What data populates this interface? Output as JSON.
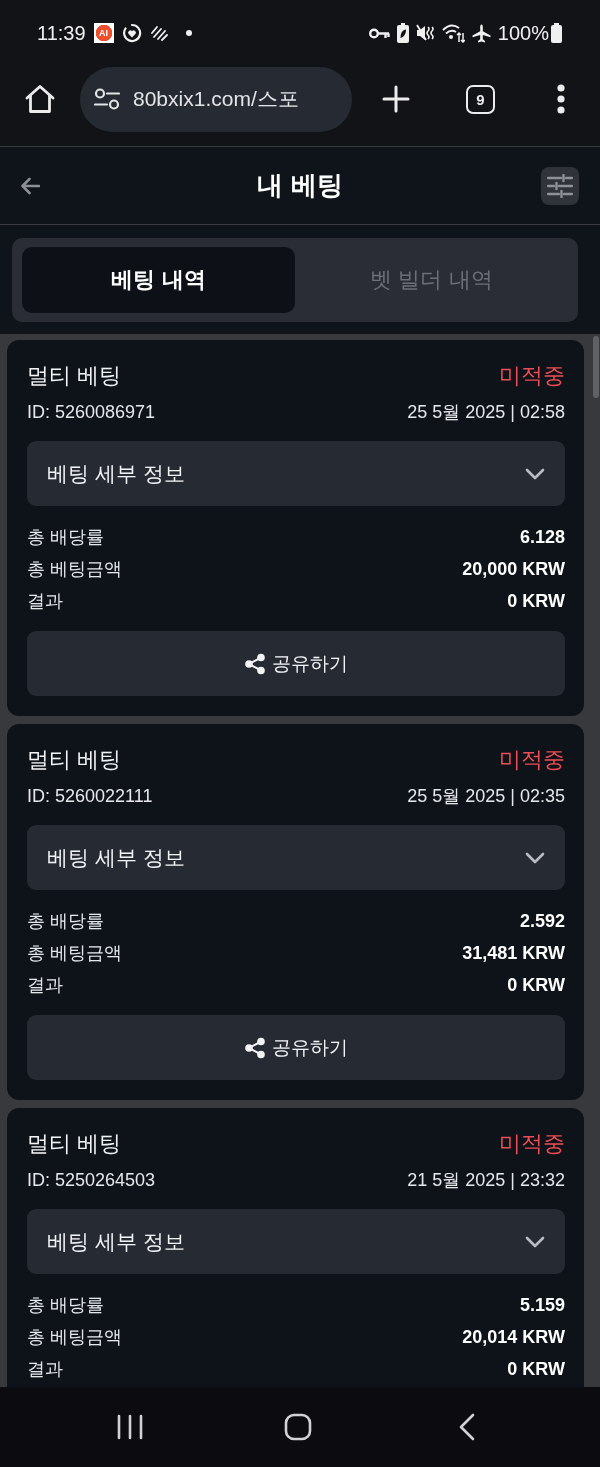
{
  "status_bar": {
    "time": "11:39",
    "app_logo": "AI",
    "battery": "100%"
  },
  "browser": {
    "url": "80bxix1.com/스포",
    "tab_count": "9"
  },
  "header": {
    "title": "내 베팅"
  },
  "tabs": [
    {
      "label": "베팅 내역",
      "selected": true
    },
    {
      "label": "벳 빌더 내역",
      "selected": false
    }
  ],
  "bets": [
    {
      "type": "멀티 베팅",
      "status": "미적중",
      "id": "ID: 5260086971",
      "date": "25 5월 2025 | 02:58",
      "details": {
        "label": "베팅 세부 정보",
        "expanded": false
      },
      "stats": [
        {
          "label": "총 배당률",
          "value": "6.128"
        },
        {
          "label": "총 베팅금액",
          "value": "20,000 KRW"
        },
        {
          "label": "결과",
          "value": "0 KRW"
        }
      ],
      "share": "공유하기"
    },
    {
      "type": "멀티 베팅",
      "status": "미적중",
      "id": "ID: 5260022111",
      "date": "25 5월 2025 | 02:35",
      "details": {
        "label": "베팅 세부 정보",
        "expanded": false
      },
      "stats": [
        {
          "label": "총 배당률",
          "value": "2.592"
        },
        {
          "label": "총 베팅금액",
          "value": "31,481 KRW"
        },
        {
          "label": "결과",
          "value": "0 KRW"
        }
      ],
      "share": "공유하기"
    },
    {
      "type": "멀티 베팅",
      "status": "미적중",
      "id": "ID: 5250264503",
      "date": "21 5월 2025 | 23:32",
      "details": {
        "label": "베팅 세부 정보",
        "expanded": false
      },
      "stats": [
        {
          "label": "총 배당률",
          "value": "5.159"
        },
        {
          "label": "총 베팅금액",
          "value": "20,014 KRW"
        },
        {
          "label": "결과",
          "value": "0 KRW"
        }
      ]
    }
  ]
}
